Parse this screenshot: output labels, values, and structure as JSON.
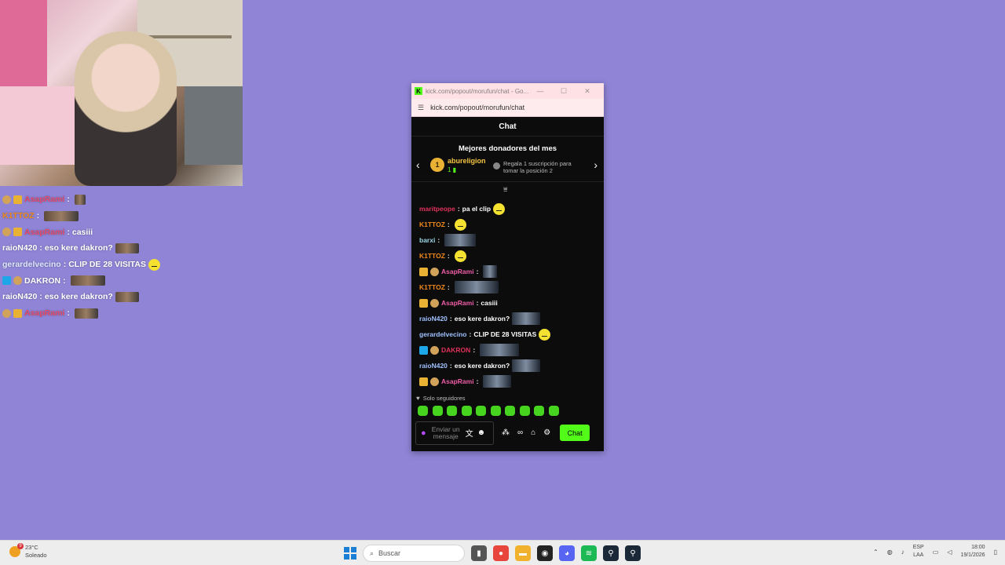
{
  "overlay_chat": [
    {
      "user": "AsapRami",
      "color": "#e34b6b",
      "message": "",
      "badges": [
        "sub",
        "crown"
      ],
      "emote": "pic",
      "emote_w": 14
    },
    {
      "user": "K1TTOZ",
      "color": "#f08a1c",
      "message": "",
      "badges": [],
      "emote": "pic",
      "emote_w": 44
    },
    {
      "user": "AsapRami",
      "color": "#e34b6b",
      "message": "casiii",
      "badges": [
        "sub",
        "crown"
      ],
      "emote": "",
      "emote_w": 0
    },
    {
      "user": "raioN420",
      "color": "#ffffff",
      "message": "eso kere dakron?",
      "badges": [],
      "emote": "pic",
      "emote_w": 30
    },
    {
      "user": "gerardelvecino",
      "color": "#dde8ff",
      "message": "CLIP DE 28 VISITAS",
      "badges": [],
      "emote": "smile",
      "emote_w": 14
    },
    {
      "user": "DAKRON",
      "color": "#ffffff",
      "message": "",
      "badges": [
        "vip",
        "sub"
      ],
      "emote": "pic",
      "emote_w": 44
    },
    {
      "user": "raioN420",
      "color": "#ffffff",
      "message": "eso kere dakron?",
      "badges": [],
      "emote": "pic",
      "emote_w": 30
    },
    {
      "user": "AsapRami",
      "color": "#e34b6b",
      "message": "",
      "badges": [
        "sub",
        "crown"
      ],
      "emote": "pic",
      "emote_w": 30
    }
  ],
  "window": {
    "tab_title": "kick.com/popout/morufun/chat - Go...",
    "min": "—",
    "max": "☐",
    "close": "✕",
    "url": "kick.com/popout/morufun/chat"
  },
  "chat": {
    "header": "Chat",
    "donors_title": "Mejores donadores del mes",
    "donor_rank": "1",
    "donor_user": "abureligion",
    "donor_count": "1 ▮",
    "gift_text": "Regala 1 suscripción para tomar la posición 2",
    "messages": [
      {
        "user": "maritpeope",
        "color": "#e0325b",
        "message": "pa el clip",
        "badges": [],
        "emote": "smile",
        "emote_w": 15
      },
      {
        "user": "K1TTOZ",
        "color": "#f08a1c",
        "message": "",
        "badges": [],
        "emote": "smile",
        "emote_w": 15
      },
      {
        "user": "barxi",
        "color": "#9bd6e6",
        "message": "",
        "badges": [],
        "emote": "pic",
        "emote_w": 40
      },
      {
        "user": "K1TTOZ",
        "color": "#f08a1c",
        "message": "",
        "badges": [],
        "emote": "smile",
        "emote_w": 15
      },
      {
        "user": "AsapRami",
        "color": "#ef5da8",
        "message": "",
        "badges": [
          "crown",
          "sub"
        ],
        "emote": "pic",
        "emote_w": 18
      },
      {
        "user": "K1TTOZ",
        "color": "#f08a1c",
        "message": "",
        "badges": [],
        "emote": "pic",
        "emote_w": 56
      },
      {
        "user": "AsapRami",
        "color": "#ef5da8",
        "message": "casiii",
        "badges": [
          "crown",
          "sub"
        ],
        "emote": "",
        "emote_w": 0
      },
      {
        "user": "raioN420",
        "color": "#9fc1ff",
        "message": "eso kere dakron?",
        "badges": [],
        "emote": "pic",
        "emote_w": 36
      },
      {
        "user": "gerardelvecino",
        "color": "#9fc1ff",
        "message": "CLIP DE 28 VISITAS",
        "badges": [],
        "emote": "smile",
        "emote_w": 15
      },
      {
        "user": "DAKRON",
        "color": "#e0325b",
        "message": "",
        "badges": [
          "vip",
          "sub"
        ],
        "emote": "pic",
        "emote_w": 50
      },
      {
        "user": "raioN420",
        "color": "#9fc1ff",
        "message": "eso kere dakron?",
        "badges": [],
        "emote": "pic",
        "emote_w": 36
      },
      {
        "user": "AsapRami",
        "color": "#ef5da8",
        "message": "",
        "badges": [
          "crown",
          "sub"
        ],
        "emote": "pic",
        "emote_w": 36
      }
    ],
    "followers_only": "Solo seguidores",
    "input_placeholder": "Enviar un mensaje",
    "send_label": "Chat"
  },
  "taskbar": {
    "temperature": "23°C",
    "weather": "Soleado",
    "weather_alert": "9",
    "search_placeholder": "Buscar",
    "lang_top": "ESP",
    "lang_bottom": "LAA",
    "time": "18:00",
    "date": "19/1/2026"
  },
  "colors": {
    "kick_green": "#53fc18",
    "background": "#8f84d6"
  }
}
